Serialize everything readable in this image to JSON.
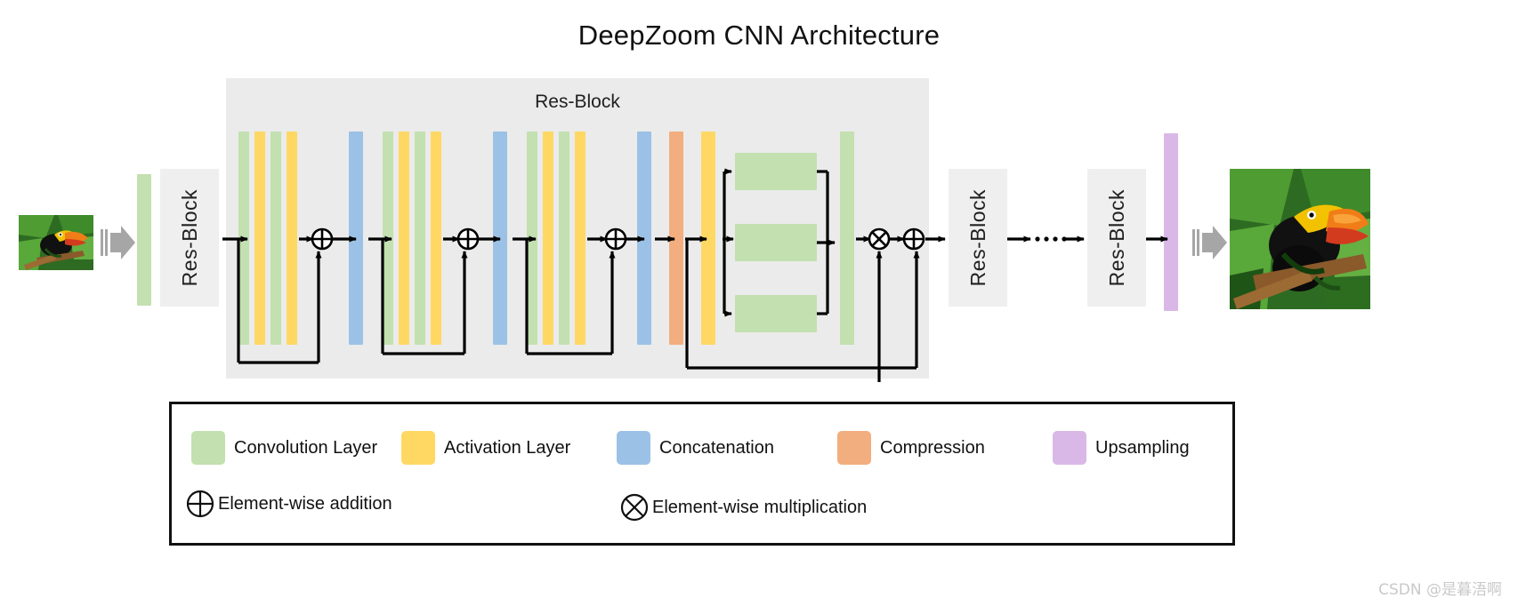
{
  "title": "DeepZoom CNN Architecture",
  "diagram": {
    "resblock_panel_title": "Res-Block",
    "resblock_label": "Res-Block",
    "ellipsis": "······",
    "blocks": [
      {
        "name": "input-image",
        "kind": "photo",
        "label": "toucan input image"
      },
      {
        "name": "input-arrow",
        "kind": "big-arrow",
        "label": "input arrow"
      },
      {
        "name": "stem-conv",
        "kind": "bar",
        "color": "#c3e0b0",
        "layer": "Convolution Layer"
      },
      {
        "name": "res-block-1",
        "kind": "resbox",
        "label": "Res-Block"
      },
      {
        "name": "res-block-expanded",
        "kind": "panel",
        "label": "Res-Block"
      },
      {
        "name": "res-block-tail-1",
        "kind": "resbox",
        "label": "Res-Block"
      },
      {
        "name": "res-block-tail-2",
        "kind": "resbox",
        "label": "Res-Block"
      },
      {
        "name": "upsampling-bar",
        "kind": "bar",
        "color": "#d9b8e8",
        "layer": "Upsampling"
      },
      {
        "name": "output-arrow",
        "kind": "big-arrow",
        "label": "output arrow"
      },
      {
        "name": "output-image",
        "kind": "photo",
        "label": "toucan output image"
      }
    ],
    "dense_groups": [
      {
        "name": "dense-group-1",
        "bars": [
          "Convolution Layer",
          "Activation Layer",
          "Convolution Layer",
          "Activation Layer"
        ]
      },
      {
        "name": "dense-group-2",
        "bars": [
          "Convolution Layer",
          "Activation Layer",
          "Convolution Layer",
          "Activation Layer"
        ]
      },
      {
        "name": "dense-group-3",
        "bars": [
          "Convolution Layer",
          "Activation Layer",
          "Convolution Layer",
          "Activation Layer"
        ]
      }
    ],
    "concatenations": [
      "Concatenation",
      "Concatenation",
      "Concatenation"
    ],
    "compression": "Compression",
    "attention_branch": {
      "activation": "Activation Layer",
      "parallel_convs": [
        "Convolution Layer",
        "Convolution Layer",
        "Convolution Layer"
      ],
      "merge_conv": "Convolution Layer"
    },
    "operators": [
      {
        "name": "add-1",
        "symbol": "⊕",
        "meaning": "Element-wise addition"
      },
      {
        "name": "add-2",
        "symbol": "⊕",
        "meaning": "Element-wise addition"
      },
      {
        "name": "add-3",
        "symbol": "⊕",
        "meaning": "Element-wise addition"
      },
      {
        "name": "multiply-1",
        "symbol": "⊗",
        "meaning": "Element-wise multiplication"
      },
      {
        "name": "add-4",
        "symbol": "⊕",
        "meaning": "Element-wise addition"
      }
    ]
  },
  "legend": {
    "swatches": [
      {
        "label": "Convolution Layer",
        "color": "#c3e0b0"
      },
      {
        "label": "Activation Layer",
        "color": "#ffd864"
      },
      {
        "label": "Concatenation",
        "color": "#9bc2e6"
      },
      {
        "label": "Compression",
        "color": "#f2ae7e"
      },
      {
        "label": "Upsampling",
        "color": "#d9b8e8"
      }
    ],
    "operators": [
      {
        "symbol": "⊕",
        "label": "Element-wise addition"
      },
      {
        "symbol": "⊗",
        "label": "Element-wise multiplication"
      }
    ]
  },
  "watermark": "CSDN @是暮浯啊",
  "colors": {
    "convolution": "#c3e0b0",
    "activation": "#ffd864",
    "concatenation": "#9bc2e6",
    "compression": "#f2ae7e",
    "upsampling": "#d9b8e8",
    "panel": "#ebebeb",
    "resbox": "#efefef",
    "wire": "#000000",
    "big_arrow": "#a6a6a6"
  }
}
